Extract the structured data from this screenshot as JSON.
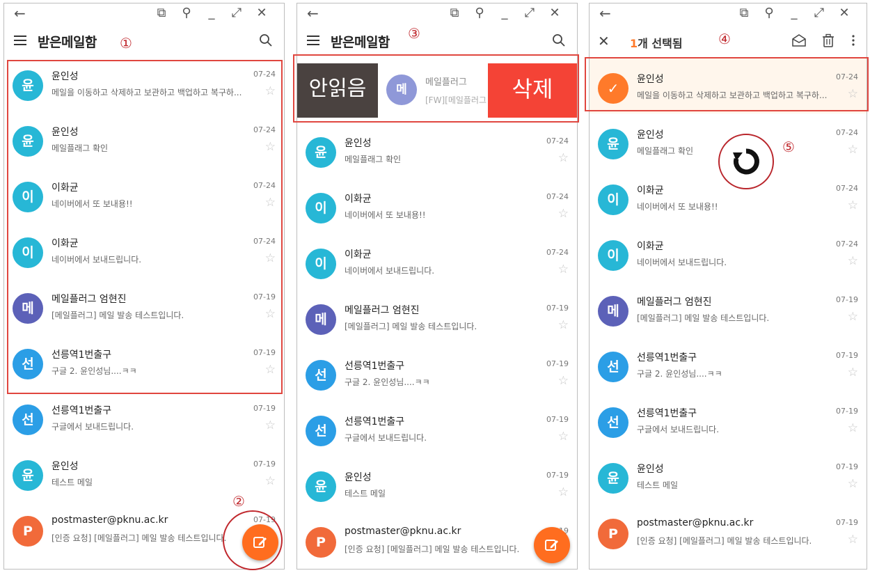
{
  "panel1": {
    "title": "받은메일함",
    "annotation_1": "①",
    "annotation_2": "②",
    "rows": [
      {
        "avatar": "윤",
        "color": "#27b7d6",
        "sender": "윤인성",
        "preview": "메일을 이동하고 삭제하고 보관하고 백업하고 복구하...",
        "date": "07-24"
      },
      {
        "avatar": "윤",
        "color": "#27b7d6",
        "sender": "윤인성",
        "preview": "메일플래그 확인",
        "date": "07-24"
      },
      {
        "avatar": "이",
        "color": "#27b7d6",
        "sender": "이화균",
        "preview": "네이버에서 또 보내용!!",
        "date": "07-24"
      },
      {
        "avatar": "이",
        "color": "#27b7d6",
        "sender": "이화균",
        "preview": "네이버에서 보내드립니다.",
        "date": "07-24"
      },
      {
        "avatar": "메",
        "color": "#5c61b8",
        "sender": "메일플러그 엄현진",
        "preview": "[메일플러그] 메일 발송 테스트입니다.",
        "date": "07-19"
      },
      {
        "avatar": "선",
        "color": "#2b9ee6",
        "sender": "선릉역1번출구",
        "preview": "구글 2. 윤인성님....ㅋㅋ",
        "date": "07-19"
      },
      {
        "avatar": "선",
        "color": "#2b9ee6",
        "sender": "선릉역1번출구",
        "preview": "구글에서 보내드립니다.",
        "date": "07-19"
      },
      {
        "avatar": "윤",
        "color": "#27b7d6",
        "sender": "윤인성",
        "preview": "테스트 메일",
        "date": "07-19"
      },
      {
        "avatar": "P",
        "color": "#f16a3a",
        "sender": "postmaster@pknu.ac.kr",
        "preview": "[인증 요청] [메일플러그] 메일 발송 테스트입니다.",
        "date": "07-19"
      }
    ]
  },
  "panel2": {
    "title": "받은메일함",
    "annotation_3": "③",
    "swipe": {
      "unread_label": "안읽음",
      "delete_label": "삭제",
      "avatar": "메",
      "sender": "메일플러그",
      "preview": "[FW][메일플러그"
    },
    "rows": [
      {
        "avatar": "윤",
        "color": "#27b7d6",
        "sender": "윤인성",
        "preview": "메일플래그 확인",
        "date": "07-24"
      },
      {
        "avatar": "이",
        "color": "#27b7d6",
        "sender": "이화균",
        "preview": "네이버에서 또 보내용!!",
        "date": "07-24"
      },
      {
        "avatar": "이",
        "color": "#27b7d6",
        "sender": "이화균",
        "preview": "네이버에서 보내드립니다.",
        "date": "07-24"
      },
      {
        "avatar": "메",
        "color": "#5c61b8",
        "sender": "메일플러그 엄현진",
        "preview": "[메일플러그] 메일 발송 테스트입니다.",
        "date": "07-19"
      },
      {
        "avatar": "선",
        "color": "#2b9ee6",
        "sender": "선릉역1번출구",
        "preview": "구글 2. 윤인성님....ㅋㅋ",
        "date": "07-19"
      },
      {
        "avatar": "선",
        "color": "#2b9ee6",
        "sender": "선릉역1번출구",
        "preview": "구글에서 보내드립니다.",
        "date": "07-19"
      },
      {
        "avatar": "윤",
        "color": "#27b7d6",
        "sender": "윤인성",
        "preview": "테스트 메일",
        "date": "07-19"
      },
      {
        "avatar": "P",
        "color": "#f16a3a",
        "sender": "postmaster@pknu.ac.kr",
        "preview": "[인증 요청] [메일플러그] 메일 발송 테스트입니다.",
        "date": "07-19"
      }
    ]
  },
  "panel3": {
    "selection_count": "1",
    "selection_label": "개 선택됨",
    "annotation_4": "④",
    "annotation_5": "⑤",
    "rows": [
      {
        "avatar": "✓",
        "color": "#ff7a2a",
        "sender": "윤인성",
        "preview": "메일을 이동하고 삭제하고 보관하고 백업하고 복구하...",
        "date": "07-24"
      },
      {
        "avatar": "윤",
        "color": "#27b7d6",
        "sender": "윤인성",
        "preview": "메일플래그 확인",
        "date": "07-24"
      },
      {
        "avatar": "이",
        "color": "#27b7d6",
        "sender": "이화균",
        "preview": "네이버에서 또 보내용!!",
        "date": "07-24"
      },
      {
        "avatar": "이",
        "color": "#27b7d6",
        "sender": "이화균",
        "preview": "네이버에서 보내드립니다.",
        "date": "07-24"
      },
      {
        "avatar": "메",
        "color": "#5c61b8",
        "sender": "메일플러그 엄현진",
        "preview": "[메일플러그] 메일 발송 테스트입니다.",
        "date": "07-19"
      },
      {
        "avatar": "선",
        "color": "#2b9ee6",
        "sender": "선릉역1번출구",
        "preview": "구글 2. 윤인성님....ㅋㅋ",
        "date": "07-19"
      },
      {
        "avatar": "선",
        "color": "#2b9ee6",
        "sender": "선릉역1번출구",
        "preview": "구글에서 보내드립니다.",
        "date": "07-19"
      },
      {
        "avatar": "윤",
        "color": "#27b7d6",
        "sender": "윤인성",
        "preview": "테스트 메일",
        "date": "07-19"
      },
      {
        "avatar": "P",
        "color": "#f16a3a",
        "sender": "postmaster@pknu.ac.kr",
        "preview": "[인증 요청] [메일플러그] 메일 발송 테스트입니다.",
        "date": "07-19"
      }
    ]
  },
  "icons": {
    "back": "back-arrow-icon",
    "snap": "snap-window-icon",
    "pin": "pin-icon",
    "minimize": "minimize-icon",
    "maximize": "maximize-icon",
    "close": "close-icon",
    "menu": "hamburger-menu-icon",
    "search": "search-icon",
    "compose": "compose-icon",
    "mark_read": "envelope-open-icon",
    "delete": "trash-icon",
    "more": "more-vertical-icon",
    "refresh": "refresh-icon",
    "star": "star-outline-icon"
  },
  "colors": {
    "accent": "#ff6d1f",
    "annotation": "#c0282d",
    "selected_bg": "#fff6ec",
    "swipe_unread": "#4a4240",
    "swipe_delete": "#f44336"
  }
}
